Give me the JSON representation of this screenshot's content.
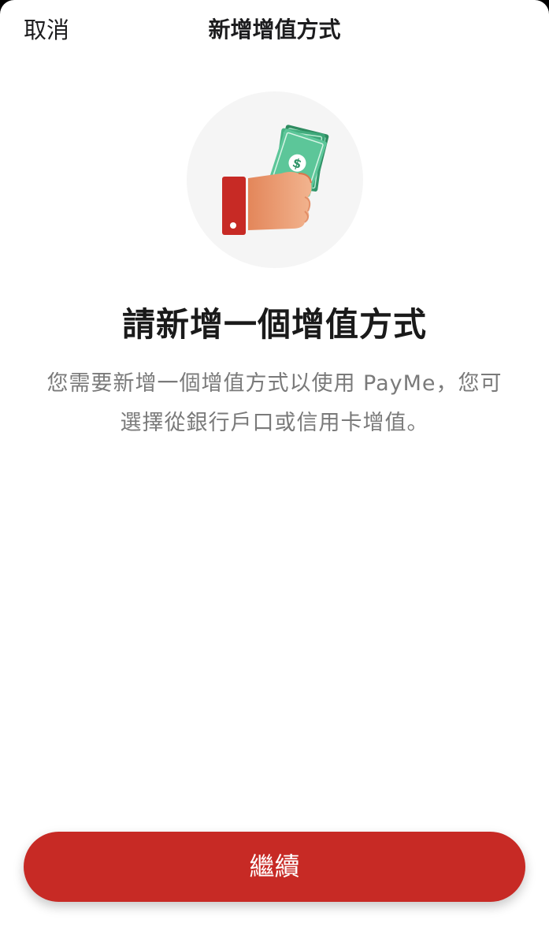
{
  "header": {
    "cancel_label": "取消",
    "title": "新增增值方式"
  },
  "hero": {
    "icon": "hand-holding-cash-icon",
    "colors": {
      "circle": "#f5f5f5",
      "cuff": "#c72a25",
      "hand": "#e89a70",
      "bill": "#3aa876"
    }
  },
  "main": {
    "headline": "請新增一個增值方式",
    "description_line1": "您需要新增一個增值方式以使用 PayMe，您可",
    "description_line2": "選擇從銀行戶口或信用卡增值。"
  },
  "footer": {
    "continue_label": "繼續",
    "accent_color": "#c72a25"
  }
}
